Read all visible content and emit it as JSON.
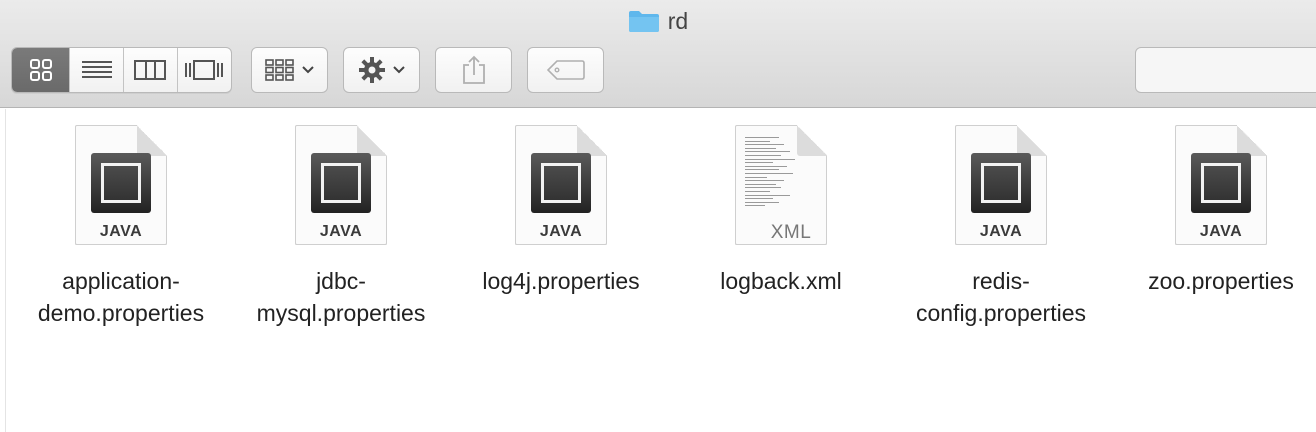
{
  "window": {
    "title": "rd"
  },
  "toolbar": {
    "view_modes": [
      "icon-view",
      "list-view",
      "column-view",
      "cover-flow-view"
    ],
    "active_view": "icon-view"
  },
  "files": [
    {
      "name": "application-demo.properties",
      "line1": "application-",
      "line2": "demo.properties",
      "type": "JAVA"
    },
    {
      "name": "jdbc-mysql.properties",
      "line1": "jdbc-",
      "line2": "mysql.properties",
      "type": "JAVA"
    },
    {
      "name": "log4j.properties",
      "line1": "log4j.properties",
      "line2": "",
      "type": "JAVA"
    },
    {
      "name": "logback.xml",
      "line1": "logback.xml",
      "line2": "",
      "type": "XML"
    },
    {
      "name": "redis-config.properties",
      "line1": "redis-",
      "line2": "config.properties",
      "type": "JAVA"
    },
    {
      "name": "zoo.properties",
      "line1": "zoo.properties",
      "line2": "",
      "type": "JAVA"
    }
  ],
  "colors": {
    "folder": "#5fb7ec",
    "active_segment": "#6f6f6f"
  }
}
